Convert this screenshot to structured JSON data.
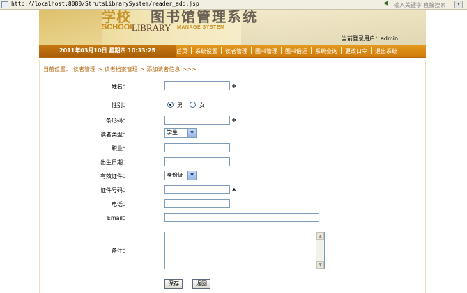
{
  "browser": {
    "url": "http://localhost:8080/StrutsLibrarySystem/reader_add.jsp",
    "search_placeholder": "输入关键字 直接搜索"
  },
  "header": {
    "school_cn": "学校",
    "title_cn": "图书馆管理系统",
    "school_en": "SCHOOL",
    "library_en": "LIBRARY",
    "manage_en": "MANAGE SYSTEM",
    "current_user": "当前登录用户：admin"
  },
  "nav": {
    "datetime": "2011年03月10日  星期四  10:33:25",
    "items": [
      "首页",
      "系统设置",
      "读者管理",
      "图书管理",
      "图书借还",
      "系统查询",
      "更改口令",
      "退出系统"
    ]
  },
  "breadcrumb": {
    "prefix": "当前位置：",
    "level1": "读者管理",
    "level2": "读者档案管理",
    "level3": "添加读者信息",
    "suffix": ">>>"
  },
  "form": {
    "name_label": "姓名：",
    "gender_label": "性别：",
    "gender_male": "男",
    "gender_female": "女",
    "barcode_label": "条形码：",
    "reader_type_label": "读者类型：",
    "reader_type_value": "学生",
    "job_label": "职业：",
    "birthday_label": "出生日期：",
    "id_type_label": "有效证件：",
    "id_type_value": "身份证",
    "id_number_label": "证件号码：",
    "phone_label": "电话：",
    "email_label": "Email：",
    "remark_label": "备注：",
    "required_mark": "*",
    "save_label": "保存",
    "back_label": "返回"
  },
  "colors": {
    "nav_bar": "#d9870f",
    "breadcrumb": "#b76a12",
    "input_border": "#7f9db9"
  }
}
